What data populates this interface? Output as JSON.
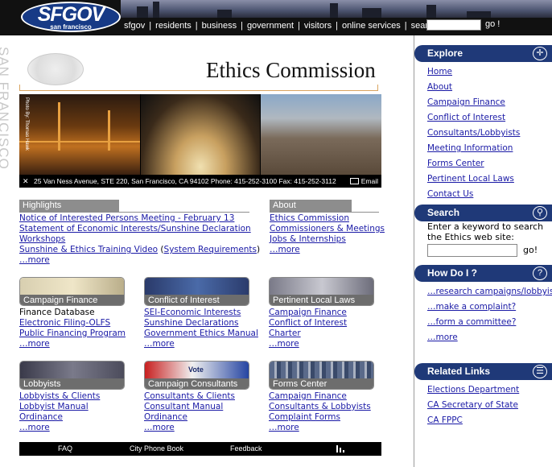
{
  "topbar": {
    "logo_main": "SFGOV",
    "logo_sub": "san francisco",
    "nav": [
      "sfgov",
      "residents",
      "business",
      "government",
      "visitors",
      "online services",
      "search"
    ],
    "go_label": "go !"
  },
  "vertical_label": "SAN FRANCISCO",
  "header": {
    "title": "Ethics Commission",
    "photo_credit": "Photo By: Thomas Hawk",
    "address": "25 Van Ness Avenue, STE 220, San Francisco, CA 94102  Phone: 415-252-3100  Fax: 415-252-3112",
    "email_label": "Email"
  },
  "highlights": {
    "heading": "Highlights",
    "lines": [
      "Notice of Interested Persons Meeting - February 13",
      "Statement of Economic Interests/Sunshine Declaration",
      "Workshops"
    ],
    "video_link": "Sunshine & Ethics Training Video",
    "video_open": " (",
    "req_link": "System Requirements",
    "video_close": ")",
    "more": "…more"
  },
  "about": {
    "heading": "About",
    "links": [
      "Ethics Commission",
      "Commissioners & Meetings",
      "Jobs & Internships"
    ],
    "more": "…more"
  },
  "tiles": [
    {
      "label": "Campaign Finance",
      "plain": "Finance Database",
      "links": [
        "Electronic Filing-OLFS",
        "Public Financing Program"
      ],
      "more": "…more"
    },
    {
      "label": "Conflict of Interest",
      "plain": "",
      "links": [
        "SEI-Economic Interests",
        "Sunshine Declarations",
        "Government Ethics Manual"
      ],
      "more": "…more"
    },
    {
      "label": "Pertinent Local Laws",
      "plain": "",
      "links": [
        "Campaign Finance",
        "Conflict of Interest",
        "Charter"
      ],
      "more": "…more"
    },
    {
      "label": "Lobbyists",
      "plain": "",
      "links": [
        "Lobbyists & Clients",
        "Lobbyist Manual",
        "Ordinance"
      ],
      "more": "…more"
    },
    {
      "label": "Campaign Consultants",
      "plain": "",
      "links": [
        "Consultants & Clients",
        "Consultant Manual",
        "Ordinance"
      ],
      "more": "…more"
    },
    {
      "label": "Forms Center",
      "plain": "",
      "links": [
        "Campaign Finance",
        "Consultants & Lobbyists",
        "Complaint Forms"
      ],
      "more": "…more"
    }
  ],
  "tile_vote_text": "Vote",
  "footer": {
    "faq": "FAQ",
    "phone": "City Phone Book",
    "feedback": "Feedback"
  },
  "explore": {
    "heading": "Explore",
    "links": [
      "Home",
      "About",
      "Campaign Finance",
      "Conflict of Interest",
      "Consultants/Lobbyists",
      "Meeting Information",
      "Forms Center",
      "Pertinent Local Laws",
      "Contact Us"
    ]
  },
  "search": {
    "heading": "Search",
    "label": "Enter a keyword to search the Ethics web site:",
    "go_label": "go!"
  },
  "howdoi": {
    "heading": "How Do I ?",
    "links": [
      "…research campaigns/lobbyists?",
      "…make a complaint?",
      "…form a committee?",
      "…more"
    ]
  },
  "related": {
    "heading": "Related Links",
    "links": [
      "Elections Department",
      "CA Secretary of State",
      "CA FPPC"
    ]
  },
  "colors": {
    "nav_blue": "#1f3978",
    "link": "#1a1aa6",
    "section_gray": "#8d8d8d"
  }
}
